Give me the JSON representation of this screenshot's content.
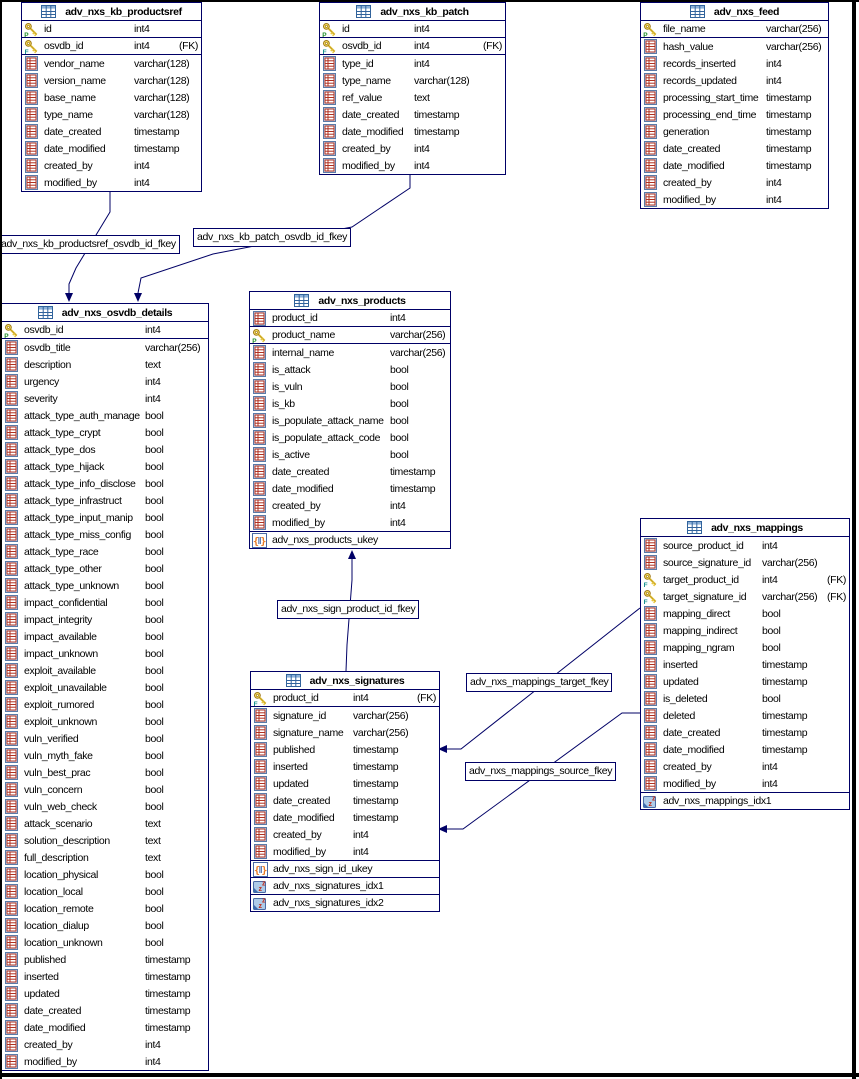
{
  "diagram": {
    "colors": {
      "connector": "#000066",
      "table_border": "#000066",
      "canvas_border": "#000000",
      "background": "#FFFFFF",
      "key_gold": "#E8C840",
      "primary_key_badge_green": "#1C8C28",
      "foreign_key_badge_teal": "#0E8C8C",
      "column_icon_red": "#B03020"
    },
    "tables": [
      {
        "name": "adv_nxs_kb_productsref",
        "header_icon": "table-icon",
        "columns": [
          {
            "icon": "pk",
            "name": "id",
            "type": "int4",
            "fk": "",
            "sep": true
          },
          {
            "icon": "fk",
            "name": "osvdb_id",
            "type": "int4",
            "fk": "(FK)",
            "sep": true
          },
          {
            "icon": "col",
            "name": "vendor_name",
            "type": "varchar(128)",
            "fk": ""
          },
          {
            "icon": "col",
            "name": "version_name",
            "type": "varchar(128)",
            "fk": ""
          },
          {
            "icon": "col",
            "name": "base_name",
            "type": "varchar(128)",
            "fk": ""
          },
          {
            "icon": "col",
            "name": "type_name",
            "type": "varchar(128)",
            "fk": ""
          },
          {
            "icon": "col",
            "name": "date_created",
            "type": "timestamp",
            "fk": ""
          },
          {
            "icon": "col",
            "name": "date_modified",
            "type": "timestamp",
            "fk": ""
          },
          {
            "icon": "col",
            "name": "created_by",
            "type": "int4",
            "fk": ""
          },
          {
            "icon": "col",
            "name": "modified_by",
            "type": "int4",
            "fk": ""
          }
        ],
        "footers": []
      },
      {
        "name": "adv_nxs_kb_patch",
        "header_icon": "table-icon",
        "columns": [
          {
            "icon": "pk",
            "name": "id",
            "type": "int4",
            "fk": "",
            "sep": true
          },
          {
            "icon": "fk",
            "name": "osvdb_id",
            "type": "int4",
            "fk": "(FK)",
            "sep": true
          },
          {
            "icon": "col",
            "name": "type_id",
            "type": "int4",
            "fk": ""
          },
          {
            "icon": "col",
            "name": "type_name",
            "type": "varchar(128)",
            "fk": ""
          },
          {
            "icon": "col",
            "name": "ref_value",
            "type": "text",
            "fk": ""
          },
          {
            "icon": "col",
            "name": "date_created",
            "type": "timestamp",
            "fk": ""
          },
          {
            "icon": "col",
            "name": "date_modified",
            "type": "timestamp",
            "fk": ""
          },
          {
            "icon": "col",
            "name": "created_by",
            "type": "int4",
            "fk": ""
          },
          {
            "icon": "col",
            "name": "modified_by",
            "type": "int4",
            "fk": ""
          }
        ],
        "footers": []
      },
      {
        "name": "adv_nxs_feed",
        "header_icon": "table-icon",
        "columns": [
          {
            "icon": "pk",
            "name": "file_name",
            "type": "varchar(256)",
            "fk": "",
            "sep": true
          },
          {
            "icon": "col",
            "name": "hash_value",
            "type": "varchar(256)",
            "fk": ""
          },
          {
            "icon": "col",
            "name": "records_inserted",
            "type": "int4",
            "fk": ""
          },
          {
            "icon": "col",
            "name": "records_updated",
            "type": "int4",
            "fk": ""
          },
          {
            "icon": "col",
            "name": "processing_start_time",
            "type": "timestamp",
            "fk": ""
          },
          {
            "icon": "col",
            "name": "processing_end_time",
            "type": "timestamp",
            "fk": ""
          },
          {
            "icon": "col",
            "name": "generation",
            "type": "timestamp",
            "fk": ""
          },
          {
            "icon": "col",
            "name": "date_created",
            "type": "timestamp",
            "fk": ""
          },
          {
            "icon": "col",
            "name": "date_modified",
            "type": "timestamp",
            "fk": ""
          },
          {
            "icon": "col",
            "name": "created_by",
            "type": "int4",
            "fk": ""
          },
          {
            "icon": "col",
            "name": "modified_by",
            "type": "int4",
            "fk": ""
          }
        ],
        "footers": []
      },
      {
        "name": "adv_nxs_osvdb_details",
        "header_icon": "table-icon",
        "columns": [
          {
            "icon": "pk",
            "name": "osvdb_id",
            "type": "int4",
            "fk": "",
            "sep": true
          },
          {
            "icon": "col",
            "name": "osvdb_title",
            "type": "varchar(256)",
            "fk": ""
          },
          {
            "icon": "col",
            "name": "description",
            "type": "text",
            "fk": ""
          },
          {
            "icon": "col",
            "name": "urgency",
            "type": "int4",
            "fk": ""
          },
          {
            "icon": "col",
            "name": "severity",
            "type": "int4",
            "fk": ""
          },
          {
            "icon": "col",
            "name": "attack_type_auth_manage",
            "type": "bool",
            "fk": ""
          },
          {
            "icon": "col",
            "name": "attack_type_crypt",
            "type": "bool",
            "fk": ""
          },
          {
            "icon": "col",
            "name": "attack_type_dos",
            "type": "bool",
            "fk": ""
          },
          {
            "icon": "col",
            "name": "attack_type_hijack",
            "type": "bool",
            "fk": ""
          },
          {
            "icon": "col",
            "name": "attack_type_info_disclose",
            "type": "bool",
            "fk": ""
          },
          {
            "icon": "col",
            "name": "attack_type_infrastruct",
            "type": "bool",
            "fk": ""
          },
          {
            "icon": "col",
            "name": "attack_type_input_manip",
            "type": "bool",
            "fk": ""
          },
          {
            "icon": "col",
            "name": "attack_type_miss_config",
            "type": "bool",
            "fk": ""
          },
          {
            "icon": "col",
            "name": "attack_type_race",
            "type": "bool",
            "fk": ""
          },
          {
            "icon": "col",
            "name": "attack_type_other",
            "type": "bool",
            "fk": ""
          },
          {
            "icon": "col",
            "name": "attack_type_unknown",
            "type": "bool",
            "fk": ""
          },
          {
            "icon": "col",
            "name": "impact_confidential",
            "type": "bool",
            "fk": ""
          },
          {
            "icon": "col",
            "name": "impact_integrity",
            "type": "bool",
            "fk": ""
          },
          {
            "icon": "col",
            "name": "impact_available",
            "type": "bool",
            "fk": ""
          },
          {
            "icon": "col",
            "name": "impact_unknown",
            "type": "bool",
            "fk": ""
          },
          {
            "icon": "col",
            "name": "exploit_available",
            "type": "bool",
            "fk": ""
          },
          {
            "icon": "col",
            "name": "exploit_unavailable",
            "type": "bool",
            "fk": ""
          },
          {
            "icon": "col",
            "name": "exploit_rumored",
            "type": "bool",
            "fk": ""
          },
          {
            "icon": "col",
            "name": "exploit_unknown",
            "type": "bool",
            "fk": ""
          },
          {
            "icon": "col",
            "name": "vuln_verified",
            "type": "bool",
            "fk": ""
          },
          {
            "icon": "col",
            "name": "vuln_myth_fake",
            "type": "bool",
            "fk": ""
          },
          {
            "icon": "col",
            "name": "vuln_best_prac",
            "type": "bool",
            "fk": ""
          },
          {
            "icon": "col",
            "name": "vuln_concern",
            "type": "bool",
            "fk": ""
          },
          {
            "icon": "col",
            "name": "vuln_web_check",
            "type": "bool",
            "fk": ""
          },
          {
            "icon": "col",
            "name": "attack_scenario",
            "type": "text",
            "fk": ""
          },
          {
            "icon": "col",
            "name": "solution_description",
            "type": "text",
            "fk": ""
          },
          {
            "icon": "col",
            "name": "full_description",
            "type": "text",
            "fk": ""
          },
          {
            "icon": "col",
            "name": "location_physical",
            "type": "bool",
            "fk": ""
          },
          {
            "icon": "col",
            "name": "location_local",
            "type": "bool",
            "fk": ""
          },
          {
            "icon": "col",
            "name": "location_remote",
            "type": "bool",
            "fk": ""
          },
          {
            "icon": "col",
            "name": "location_dialup",
            "type": "bool",
            "fk": ""
          },
          {
            "icon": "col",
            "name": "location_unknown",
            "type": "bool",
            "fk": ""
          },
          {
            "icon": "col",
            "name": "published",
            "type": "timestamp",
            "fk": ""
          },
          {
            "icon": "col",
            "name": "inserted",
            "type": "timestamp",
            "fk": ""
          },
          {
            "icon": "col",
            "name": "updated",
            "type": "timestamp",
            "fk": ""
          },
          {
            "icon": "col",
            "name": "date_created",
            "type": "timestamp",
            "fk": ""
          },
          {
            "icon": "col",
            "name": "date_modified",
            "type": "timestamp",
            "fk": ""
          },
          {
            "icon": "col",
            "name": "created_by",
            "type": "int4",
            "fk": ""
          },
          {
            "icon": "col",
            "name": "modified_by",
            "type": "int4",
            "fk": ""
          }
        ],
        "footers": []
      },
      {
        "name": "adv_nxs_products",
        "header_icon": "table-icon",
        "columns": [
          {
            "icon": "col",
            "name": "product_id",
            "type": "int4",
            "fk": "",
            "sep": true
          },
          {
            "icon": "pk",
            "name": "product_name",
            "type": "varchar(256)",
            "fk": "",
            "sep": true
          },
          {
            "icon": "col",
            "name": "internal_name",
            "type": "varchar(256)",
            "fk": ""
          },
          {
            "icon": "col",
            "name": "is_attack",
            "type": "bool",
            "fk": ""
          },
          {
            "icon": "col",
            "name": "is_vuln",
            "type": "bool",
            "fk": ""
          },
          {
            "icon": "col",
            "name": "is_kb",
            "type": "bool",
            "fk": ""
          },
          {
            "icon": "col",
            "name": "is_populate_attack_name",
            "type": "bool",
            "fk": ""
          },
          {
            "icon": "col",
            "name": "is_populate_attack_code",
            "type": "bool",
            "fk": ""
          },
          {
            "icon": "col",
            "name": "is_active",
            "type": "bool",
            "fk": ""
          },
          {
            "icon": "col",
            "name": "date_created",
            "type": "timestamp",
            "fk": ""
          },
          {
            "icon": "col",
            "name": "date_modified",
            "type": "timestamp",
            "fk": ""
          },
          {
            "icon": "col",
            "name": "created_by",
            "type": "int4",
            "fk": ""
          },
          {
            "icon": "col",
            "name": "modified_by",
            "type": "int4",
            "fk": ""
          }
        ],
        "footers": [
          {
            "icon": "ukey",
            "name": "adv_nxs_products_ukey"
          }
        ]
      },
      {
        "name": "adv_nxs_signatures",
        "header_icon": "table-icon",
        "columns": [
          {
            "icon": "fk",
            "name": "product_id",
            "type": "int4",
            "fk": "(FK)",
            "sep": true
          },
          {
            "icon": "col",
            "name": "signature_id",
            "type": "varchar(256)",
            "fk": ""
          },
          {
            "icon": "col",
            "name": "signature_name",
            "type": "varchar(256)",
            "fk": ""
          },
          {
            "icon": "col",
            "name": "published",
            "type": "timestamp",
            "fk": ""
          },
          {
            "icon": "col",
            "name": "inserted",
            "type": "timestamp",
            "fk": ""
          },
          {
            "icon": "col",
            "name": "updated",
            "type": "timestamp",
            "fk": ""
          },
          {
            "icon": "col",
            "name": "date_created",
            "type": "timestamp",
            "fk": ""
          },
          {
            "icon": "col",
            "name": "date_modified",
            "type": "timestamp",
            "fk": ""
          },
          {
            "icon": "col",
            "name": "created_by",
            "type": "int4",
            "fk": ""
          },
          {
            "icon": "col",
            "name": "modified_by",
            "type": "int4",
            "fk": ""
          }
        ],
        "footers": [
          {
            "icon": "ukey",
            "name": "adv_nxs_sign_id_ukey"
          },
          {
            "icon": "idx",
            "name": "adv_nxs_signatures_idx1"
          },
          {
            "icon": "idx",
            "name": "adv_nxs_signatures_idx2"
          }
        ]
      },
      {
        "name": "adv_nxs_mappings",
        "header_icon": "table-icon",
        "columns": [
          {
            "icon": "col",
            "name": "source_product_id",
            "type": "int4",
            "fk": ""
          },
          {
            "icon": "col",
            "name": "source_signature_id",
            "type": "varchar(256)",
            "fk": ""
          },
          {
            "icon": "fk",
            "name": "target_product_id",
            "type": "int4",
            "fk": "(FK)"
          },
          {
            "icon": "fk",
            "name": "target_signature_id",
            "type": "varchar(256)",
            "fk": "(FK)"
          },
          {
            "icon": "col",
            "name": "mapping_direct",
            "type": "bool",
            "fk": ""
          },
          {
            "icon": "col",
            "name": "mapping_indirect",
            "type": "bool",
            "fk": ""
          },
          {
            "icon": "col",
            "name": "mapping_ngram",
            "type": "bool",
            "fk": ""
          },
          {
            "icon": "col",
            "name": "inserted",
            "type": "timestamp",
            "fk": ""
          },
          {
            "icon": "col",
            "name": "updated",
            "type": "timestamp",
            "fk": ""
          },
          {
            "icon": "col",
            "name": "is_deleted",
            "type": "bool",
            "fk": ""
          },
          {
            "icon": "col",
            "name": "deleted",
            "type": "timestamp",
            "fk": ""
          },
          {
            "icon": "col",
            "name": "date_created",
            "type": "timestamp",
            "fk": ""
          },
          {
            "icon": "col",
            "name": "date_modified",
            "type": "timestamp",
            "fk": ""
          },
          {
            "icon": "col",
            "name": "created_by",
            "type": "int4",
            "fk": ""
          },
          {
            "icon": "col",
            "name": "modified_by",
            "type": "int4",
            "fk": ""
          }
        ],
        "footers": [
          {
            "icon": "idx",
            "name": "adv_nxs_mappings_idx1"
          }
        ]
      }
    ],
    "relationship_labels": [
      {
        "text": "adv_nxs_kb_productsref_osvdb_id_fkey"
      },
      {
        "text": "adv_nxs_kb_patch_osvdb_id_fkey"
      },
      {
        "text": "adv_nxs_sign_product_id_fkey"
      },
      {
        "text": "adv_nxs_mappings_target_fkey"
      },
      {
        "text": "adv_nxs_mappings_source_fkey"
      }
    ]
  }
}
